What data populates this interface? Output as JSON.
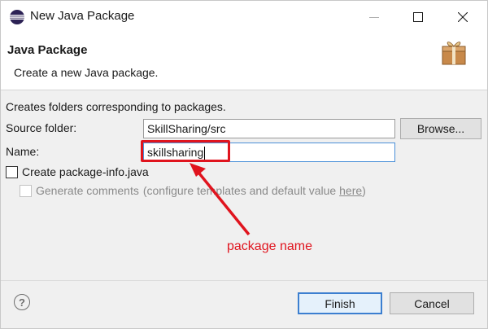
{
  "window": {
    "title": "New Java Package"
  },
  "banner": {
    "title": "Java Package",
    "description": "Create a new Java package."
  },
  "form": {
    "note": "Creates folders corresponding to packages.",
    "source_folder_label": "Source folder:",
    "source_folder_value": "SkillSharing/src",
    "browse_label": "Browse...",
    "name_label": "Name:",
    "name_value": "skillsharing",
    "create_info_label": "Create package-info.java",
    "generate_comments_label": "Generate comments",
    "generate_comments_note_a": "(configure te",
    "generate_comments_note_b": "mplates and default value ",
    "generate_comments_link": "here",
    "generate_comments_note_c": ")"
  },
  "annotation": {
    "label": "package name",
    "color": "#e0141e"
  },
  "footer": {
    "finish_label": "Finish",
    "cancel_label": "Cancel",
    "help_symbol": "?"
  }
}
